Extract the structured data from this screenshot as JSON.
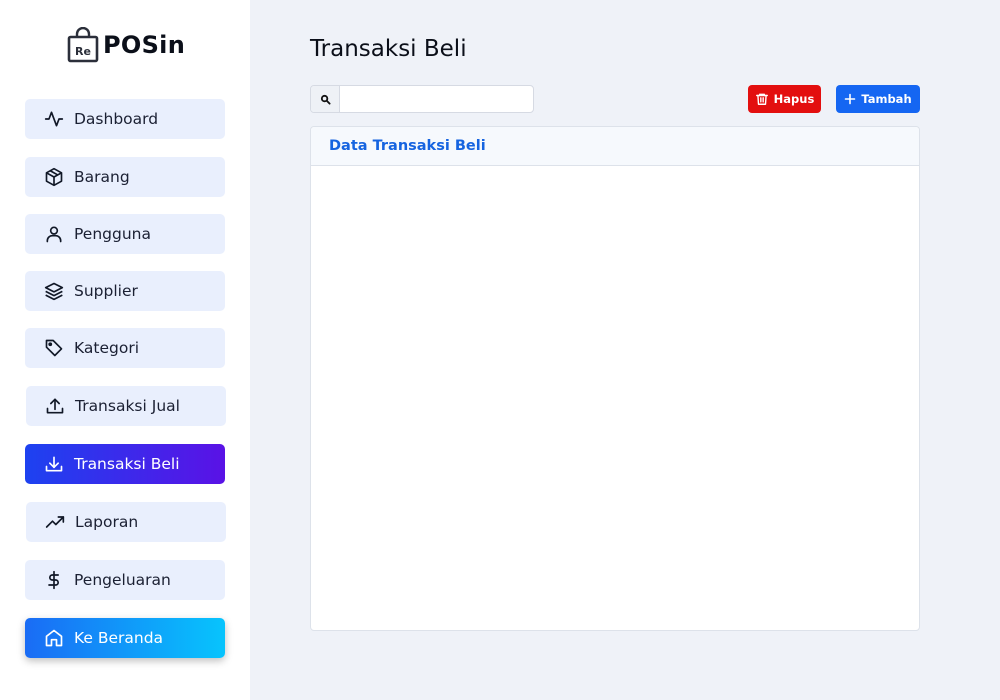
{
  "brand": {
    "badge": "Re",
    "name": "POSin"
  },
  "sidebar": {
    "items": [
      {
        "label": "Dashboard",
        "icon": "activity-icon"
      },
      {
        "label": "Barang",
        "icon": "box-icon"
      },
      {
        "label": "Pengguna",
        "icon": "user-icon"
      },
      {
        "label": "Supplier",
        "icon": "layers-icon"
      },
      {
        "label": "Kategori",
        "icon": "tag-icon"
      },
      {
        "label": "Transaksi Jual",
        "icon": "upload-icon"
      },
      {
        "label": "Transaksi Beli",
        "icon": "download-icon",
        "active": true
      },
      {
        "label": "Laporan",
        "icon": "trending-up-icon"
      },
      {
        "label": "Pengeluaran",
        "icon": "dollar-icon"
      }
    ],
    "home": {
      "label": "Ke Beranda",
      "icon": "home-icon"
    }
  },
  "main": {
    "title": "Transaksi Beli",
    "search": {
      "value": "",
      "placeholder": ""
    },
    "buttons": {
      "delete": "Hapus",
      "add": "Tambah"
    },
    "card": {
      "title": "Data Transaksi Beli"
    }
  },
  "colors": {
    "active_gradient": [
      "#1d42f0",
      "#5a12e6"
    ],
    "home_gradient": [
      "#1a6cf5",
      "#07c4fd"
    ],
    "delete": "#e30f0f",
    "add": "#1566f2",
    "accent_text": "#1664e0"
  }
}
